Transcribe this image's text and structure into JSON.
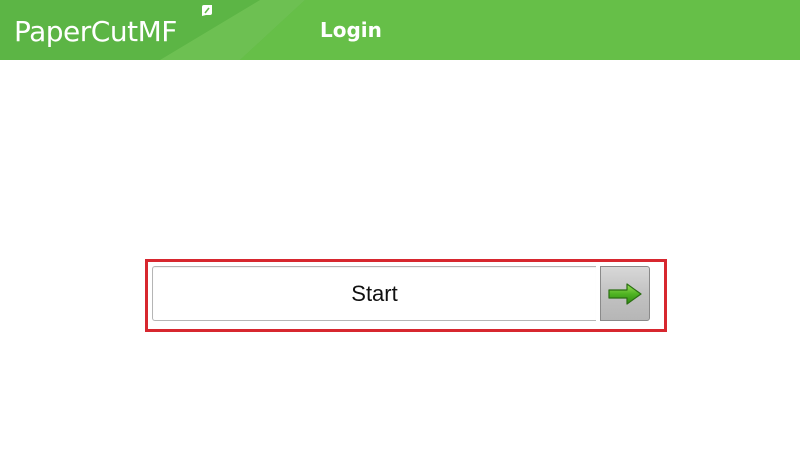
{
  "header": {
    "brand": "PaperCutMF",
    "title": "Login",
    "background_color": "#62bb46"
  },
  "login": {
    "start_label": "Start",
    "highlight_color": "#d7272f",
    "go_icon": "right-arrow-icon"
  }
}
